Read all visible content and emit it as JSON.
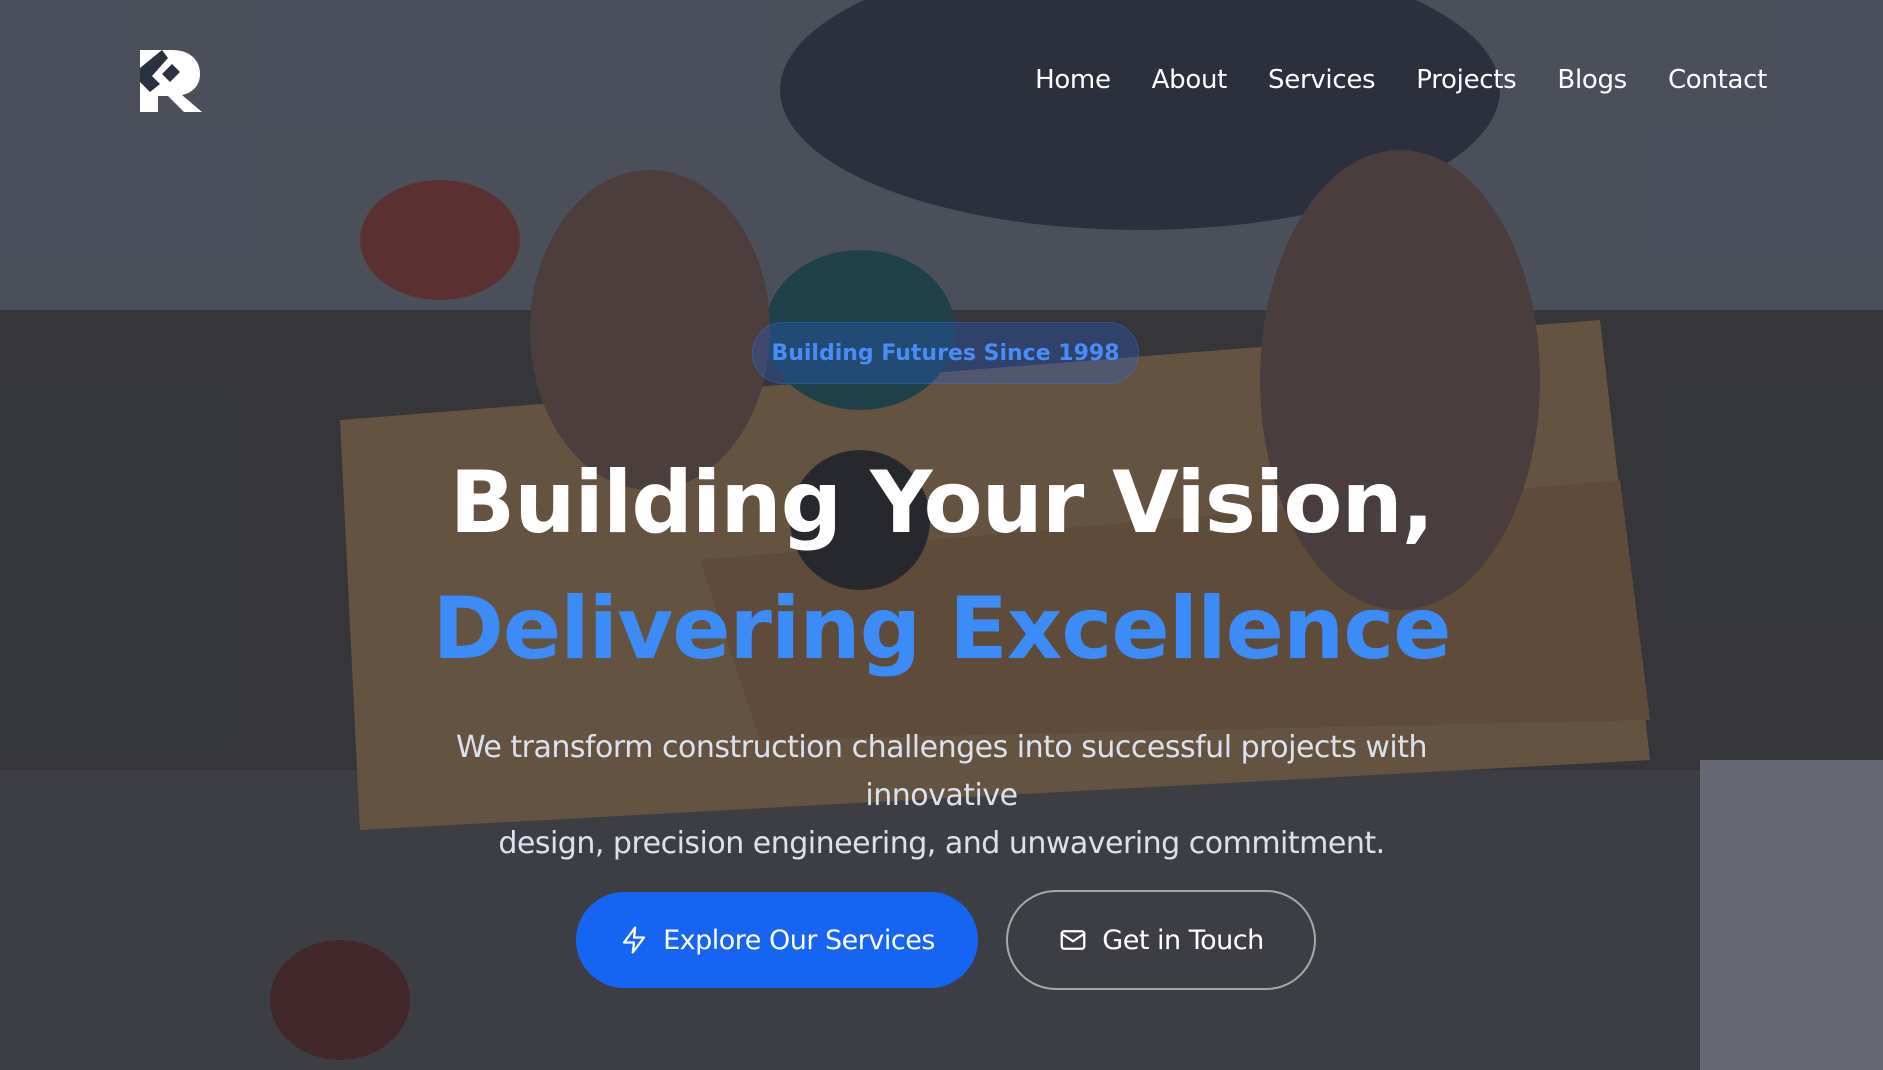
{
  "nav": {
    "logo_icon": "builder-logo-icon",
    "items": [
      "Home",
      "About",
      "Services",
      "Projects",
      "Blogs",
      "Contact"
    ]
  },
  "hero": {
    "badge": "Building Futures Since 1998",
    "title_line1": "Building Your Vision,",
    "title_line2": "Delivering Excellence",
    "subtitle_line1": "We transform construction challenges into successful projects with innovative",
    "subtitle_line2": "design, precision engineering, and unwavering commitment.",
    "primary_button": {
      "label": "Explore Our Services",
      "icon": "lightning-icon"
    },
    "secondary_button": {
      "label": "Get in Touch",
      "icon": "mail-icon"
    }
  },
  "colors": {
    "accent": "#1664f2",
    "title_highlight": "#3d8bf7",
    "badge_text": "#4a8cf5"
  }
}
